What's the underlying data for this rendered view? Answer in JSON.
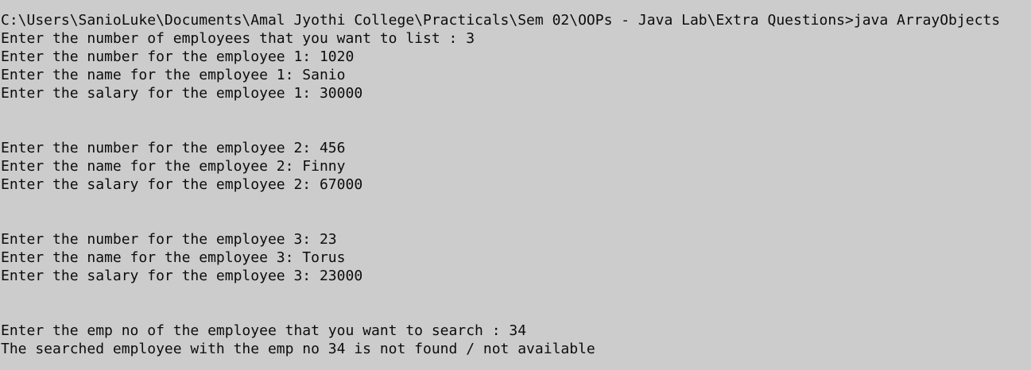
{
  "console": {
    "lines": [
      "C:\\Users\\SanioLuke\\Documents\\Amal Jyothi College\\Practicals\\Sem 02\\OOPs - Java Lab\\Extra Questions>java ArrayObjects",
      "Enter the number of employees that you want to list : 3",
      "Enter the number for the employee 1: 1020",
      "Enter the name for the employee 1: Sanio",
      "Enter the salary for the employee 1: 30000",
      "",
      "",
      "Enter the number for the employee 2: 456",
      "Enter the name for the employee 2: Finny",
      "Enter the salary for the employee 2: 67000",
      "",
      "",
      "Enter the number for the employee 3: 23",
      "Enter the name for the employee 3: Torus",
      "Enter the salary for the employee 3: 23000",
      "",
      "",
      "Enter the emp no of the employee that you want to search : 34",
      "The searched employee with the emp no 34 is not found / not available"
    ]
  }
}
